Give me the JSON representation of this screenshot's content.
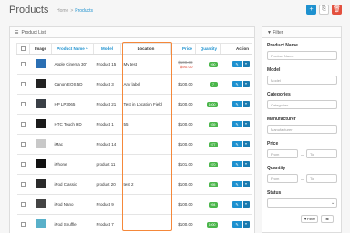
{
  "header": {
    "title": "Products",
    "breadcrumb": [
      "Home",
      "Products"
    ],
    "add_label": "+",
    "copy_label": "⎘",
    "delete_label": "🗑"
  },
  "list": {
    "heading": "Product List",
    "columns": [
      "Image",
      "Product Name ^",
      "Model",
      "Location",
      "Price",
      "Quantity",
      "Action"
    ],
    "rows": [
      {
        "name": "Apple Cinema 30\"",
        "model": "Product 15",
        "location": "My test",
        "price_old": "$100.00",
        "price": "$90.00",
        "qty": "990",
        "qty_warn": false,
        "thumb_color": "#2b6fb3"
      },
      {
        "name": "Canon EOS 5D",
        "model": "Product 3",
        "location": "Any label",
        "price": "$100.00",
        "qty": "7",
        "qty_warn": false,
        "thumb_color": "#222222"
      },
      {
        "name": "HP LP3065",
        "model": "Product 21",
        "location": "Test in Location Field",
        "price": "$100.00",
        "qty": "1000",
        "qty_warn": false,
        "thumb_color": "#3a3f46"
      },
      {
        "name": "HTC Touch HD",
        "model": "Product 1",
        "location": "55",
        "price": "$100.00",
        "qty": "939",
        "qty_warn": false,
        "thumb_color": "#1a1a1a"
      },
      {
        "name": "iMac",
        "model": "Product 14",
        "location": "",
        "price": "$100.00",
        "qty": "977",
        "qty_warn": false,
        "thumb_color": "#c8c8c8"
      },
      {
        "name": "iPhone",
        "model": "product 11",
        "location": "",
        "price": "$101.00",
        "qty": "970",
        "qty_warn": false,
        "thumb_color": "#111111"
      },
      {
        "name": "iPod Classic",
        "model": "product 20",
        "location": "test 2",
        "price": "$100.00",
        "qty": "995",
        "qty_warn": false,
        "thumb_color": "#2a2a2a"
      },
      {
        "name": "iPod Nano",
        "model": "Product 9",
        "location": "",
        "price": "$100.00",
        "qty": "994",
        "qty_warn": false,
        "thumb_color": "#444444"
      },
      {
        "name": "iPod Shuffle",
        "model": "Product 7",
        "location": "",
        "price": "$100.00",
        "qty": "1000",
        "qty_warn": false,
        "thumb_color": "#59b0c9"
      }
    ]
  },
  "filter": {
    "heading": "Filter",
    "product_name_label": "Product Name",
    "product_name_placeholder": "Product Name",
    "model_label": "Model",
    "model_placeholder": "Model",
    "categories_label": "Categories",
    "categories_placeholder": "Categories",
    "manufacturer_label": "Manufacturer",
    "manufacturer_placeholder": "Manufacturer",
    "price_label": "Price",
    "price_from": "From",
    "price_to": "To",
    "quantity_label": "Quantity",
    "qty_from": "From",
    "qty_to": "To",
    "status_label": "Status",
    "filter_button": "Filter",
    "reset_button": "⇆"
  },
  "colors": {
    "accent": "#1e91cf",
    "danger": "#e3503e",
    "highlight": "#f5883a",
    "stock": "#4cb64c"
  }
}
